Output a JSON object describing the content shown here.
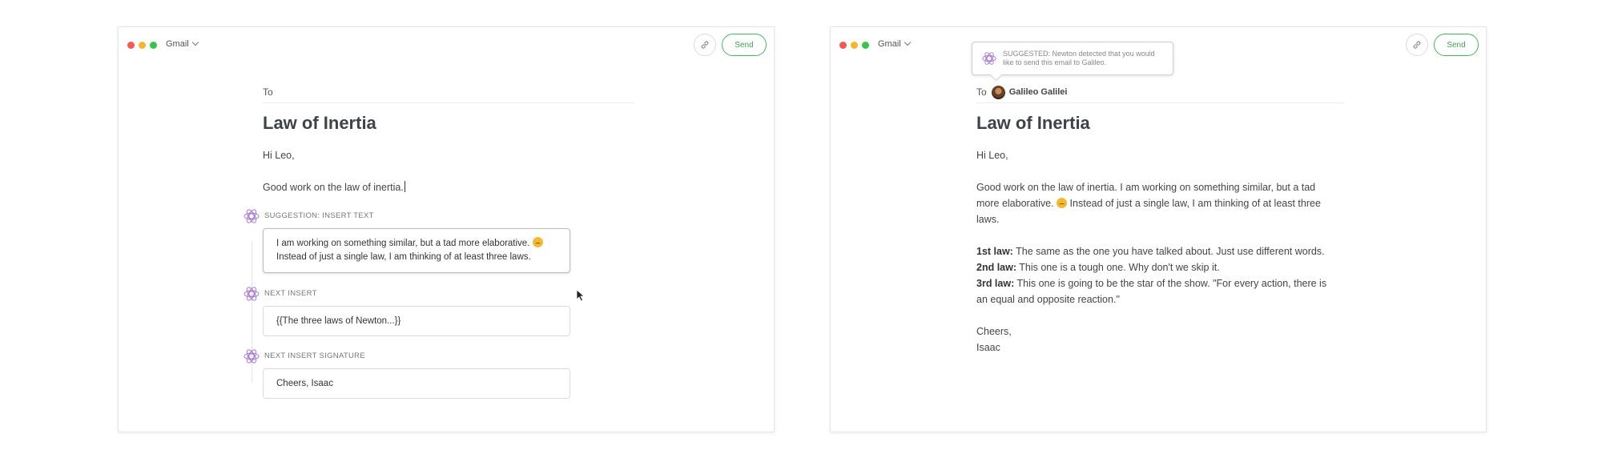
{
  "colors": {
    "accent": "#3aa64f",
    "suggestion": "#a97bd6"
  },
  "left": {
    "app": "Gmail",
    "send_label": "Send",
    "to_label": "To",
    "subject": "Law of Inertia",
    "greeting": "Hi Leo,",
    "line1": "Good work on the law of inertia.",
    "suggestions": [
      {
        "label": "SUGGESTION: INSERT TEXT",
        "line1": "I am working on something similar, but a tad more elaborative.",
        "line2": "Instead of just a single law, I am thinking of at least three laws."
      },
      {
        "label": "NEXT INSERT",
        "text": "{{The three laws of Newton...}}"
      },
      {
        "label": "NEXT INSERT SIGNATURE",
        "text": "Cheers, Isaac"
      }
    ]
  },
  "right": {
    "app": "Gmail",
    "send_label": "Send",
    "tooltip": "SUGGESTED: Newton detected that you would like to send this email to Galileo.",
    "to_label": "To",
    "recipient": "Galileo Galilei",
    "subject": "Law of Inertia",
    "greeting": "Hi Leo,",
    "para_a": "Good work on the law of inertia. I am working on something similar, but a tad",
    "para_b1": "more elaborative.",
    "para_b2": "Instead of just a single law, I am thinking of at least three",
    "para_c": "laws.",
    "laws": [
      {
        "name": "1st law:",
        "text": "The same as the one you have talked about. Just use different words."
      },
      {
        "name": "2nd law:",
        "text": "This one is a tough one. Why don't we skip it."
      },
      {
        "name": "3rd law:",
        "text": "This one is going to be the star of the show. \"For every action, there is"
      }
    ],
    "law3_cont": "an equal and opposite reaction.\"",
    "signoff": "Cheers,",
    "signature": "Isaac"
  }
}
